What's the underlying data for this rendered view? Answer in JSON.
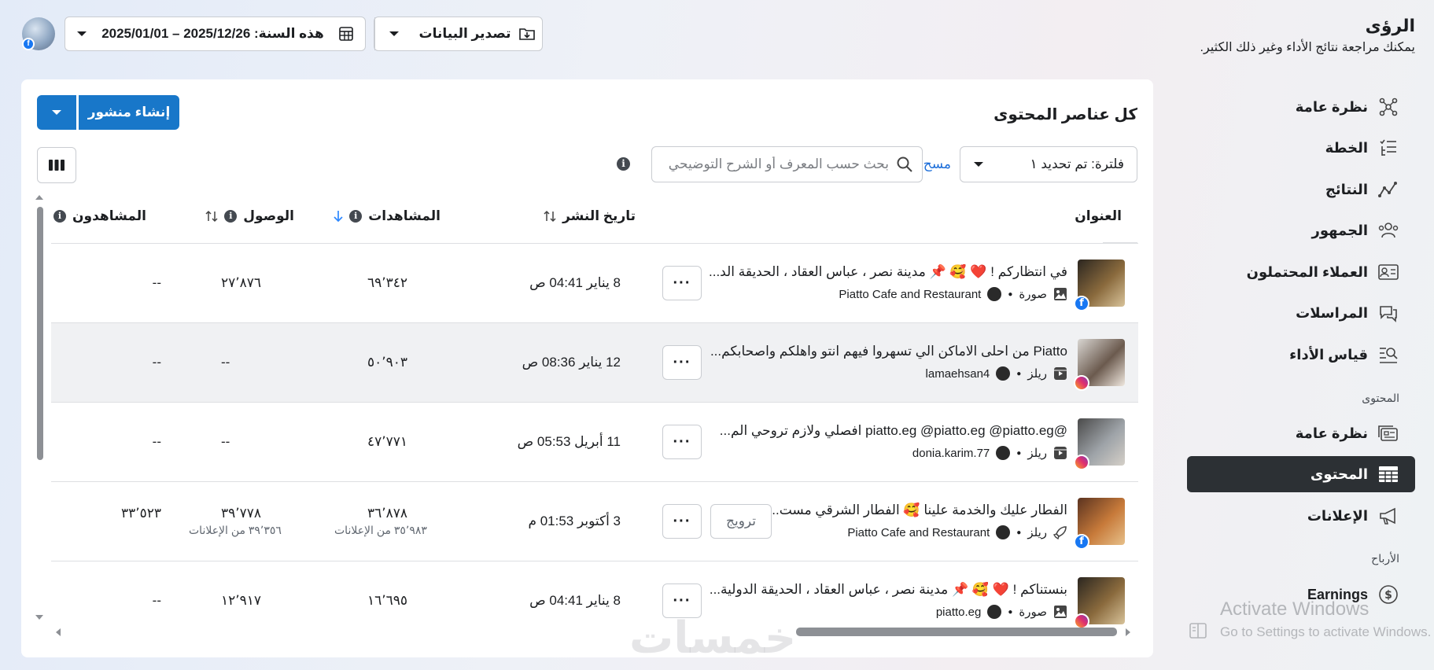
{
  "header": {
    "title": "الرؤى",
    "subtitle": "يمكنك مراجعة نتائج الأداء وغير ذلك الكثير.",
    "date_range": "هذه السنة: 2025/12/26 – 2025/01/01",
    "export_label": "تصدير البيانات"
  },
  "sidebar": {
    "items": [
      {
        "label": "نظرة عامة",
        "icon": "network-icon"
      },
      {
        "label": "الخطة",
        "icon": "checklist-icon"
      },
      {
        "label": "النتائج",
        "icon": "trend-line-icon"
      },
      {
        "label": "الجمهور",
        "icon": "people-icon"
      },
      {
        "label": "العملاء المحتملون",
        "icon": "contact-card-icon"
      },
      {
        "label": "المراسلات",
        "icon": "chat-bubbles-icon"
      },
      {
        "label": "قياس الأداء",
        "icon": "benchmark-icon"
      }
    ],
    "content_section": "المحتوى",
    "content_items": [
      {
        "label": "نظرة عامة",
        "icon": "media-overview-icon"
      },
      {
        "label": "المحتوى",
        "icon": "table-grid-icon"
      },
      {
        "label": "الإعلانات",
        "icon": "megaphone-icon"
      }
    ],
    "earnings_section": "الأرباح",
    "earnings_item": {
      "label": "Earnings",
      "icon": "dollar-circle-icon"
    }
  },
  "card": {
    "title": "كل عناصر المحتوى",
    "create_post": "إنشاء منشور",
    "filter_label": "فلترة: تم تحديد ١",
    "clear_label": "مسح",
    "search_placeholder": "بحث حسب المعرف أو الشرح التوضيحي"
  },
  "table": {
    "columns": {
      "title": "العنوان",
      "publish_date": "تاريخ النشر",
      "views": "المشاهدات",
      "reach": "الوصول",
      "viewers": "المشاهدون"
    },
    "rows": [
      {
        "title": "في انتظاركم ! ❤️ 🥰 📌 مدينة نصر ، عباس العقاد ، الحديقة الد...",
        "type": "صورة",
        "account": "Piatto Cafe and Restaurant",
        "platform": "facebook",
        "date": "8 يناير 04:41 ص",
        "views": "٦٩٬٣٤٢",
        "reach": "٢٧٬٨٧٦",
        "viewers": "--",
        "highlighted": false
      },
      {
        "title": "Piatto من احلى الاماكن الي تسهروا فيهم انتو واهلكم واصحابكم...",
        "type": "ريلز",
        "account": "lamaehsan4",
        "platform": "instagram",
        "date": "12 يناير 08:36 ص",
        "views": "٥٠٬٩٠٣",
        "reach": "--",
        "viewers": "--",
        "highlighted": true
      },
      {
        "title": "@piatto.eg @piatto.eg @piatto.eg افصلي ولازم تروحي الم...",
        "type": "ريلز",
        "account": "donia.karim.77",
        "platform": "instagram",
        "date": "11 أبريل 05:53 ص",
        "views": "٤٧٬٧٧١",
        "reach": "--",
        "viewers": "--",
        "highlighted": false
      },
      {
        "title": "الفطار عليك والخدمة علينا 🥰 الفطار الشرقي مست...",
        "type": "ريلز",
        "account": "Piatto Cafe and Restaurant",
        "platform": "facebook",
        "boost": "ترويج",
        "date": "3 أكتوبر 01:53 م",
        "views": "٣٦٬٨٧٨",
        "views_sub": "٣٥٬٩٨٣ من الإعلانات",
        "reach": "٣٩٬٧٧٨",
        "reach_sub": "٣٩٬٣٥٦ من الإعلانات",
        "viewers": "٣٣٬٥٢٣",
        "highlighted": false
      },
      {
        "title": "بنستناكم ! ❤️ 🥰 📌 مدينة نصر ، عباس العقاد ، الحديقة الدولية...",
        "type": "صورة",
        "account": "piatto.eg",
        "platform": "instagram",
        "date": "8 يناير 04:41 ص",
        "views": "١٦٬٦٩٥",
        "reach": "١٢٬٩١٧",
        "viewers": "--",
        "highlighted": false
      }
    ]
  },
  "watermark": {
    "line1": "Activate Windows",
    "line2": "Go to Settings to activate Windows.",
    "logo": "خمسات"
  },
  "colors": {
    "primary": "#1877c9",
    "active_nav": "#2c3034",
    "link": "#1e6fd9"
  }
}
